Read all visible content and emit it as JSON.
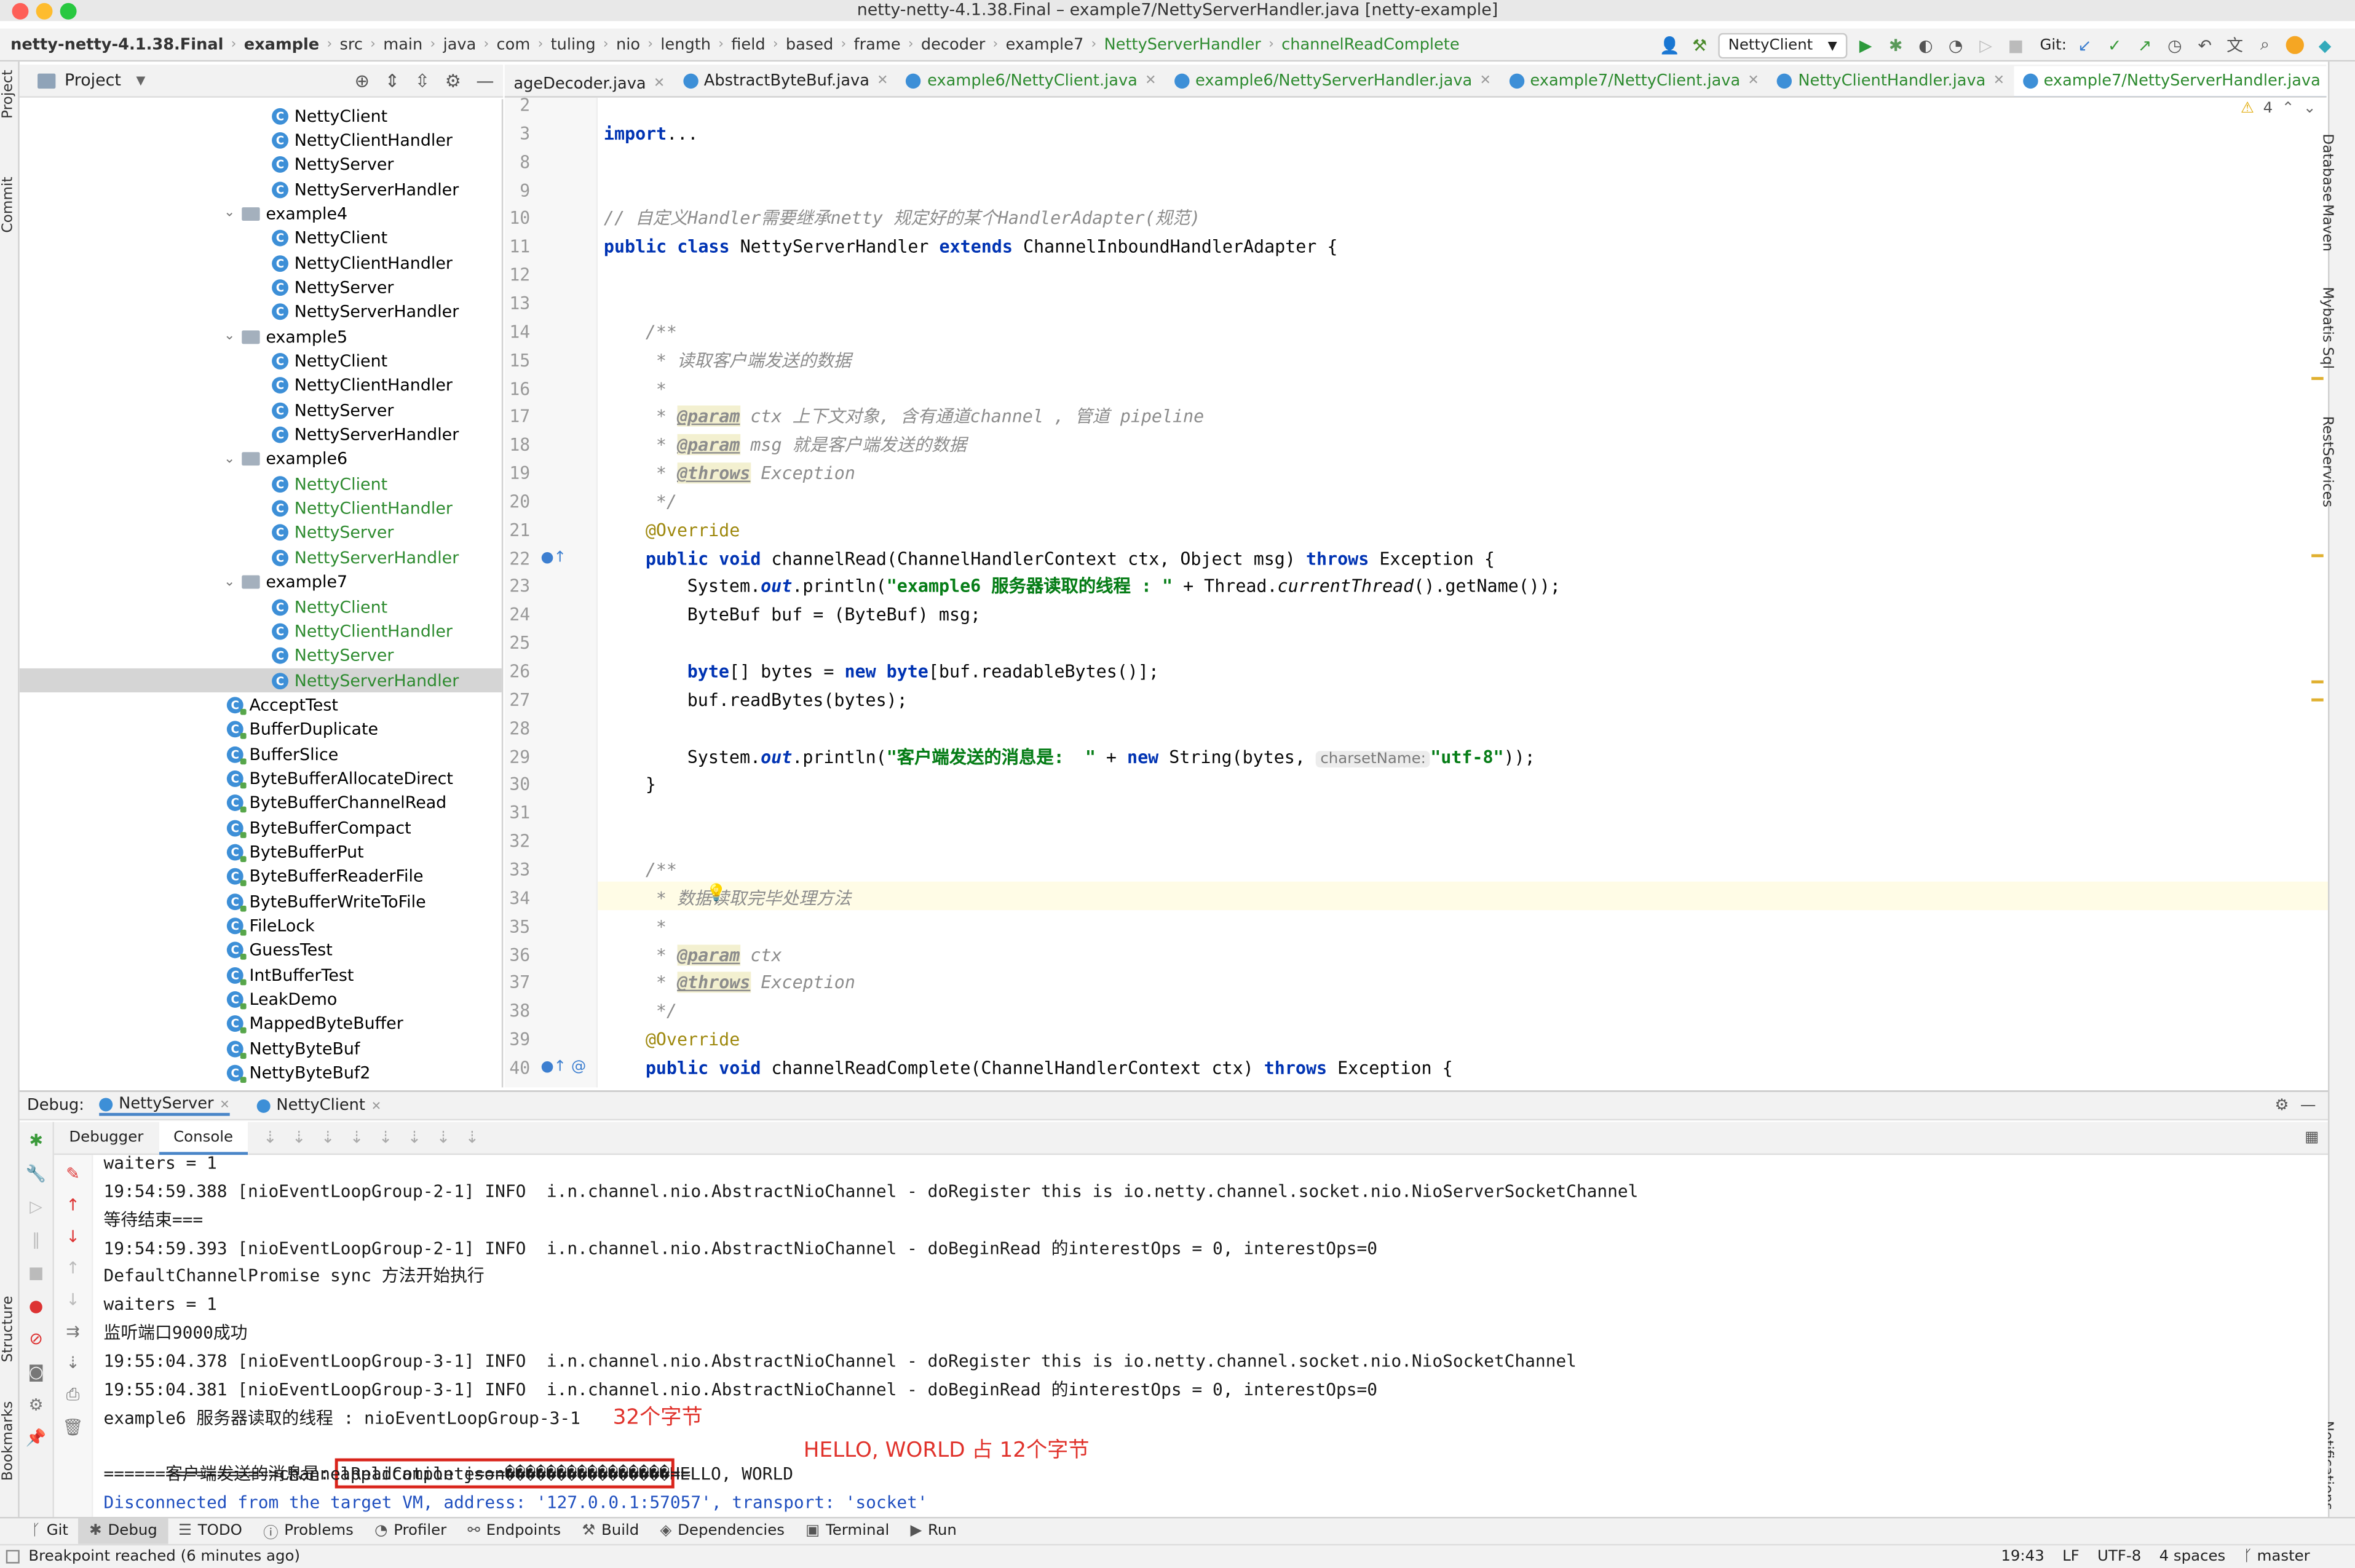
{
  "window": {
    "title": "netty-netty-4.1.38.Final – example7/NettyServerHandler.java [netty-example]"
  },
  "breadcrumbs": [
    "netty-netty-4.1.38.Final",
    "example",
    "src",
    "main",
    "java",
    "com",
    "tuling",
    "nio",
    "length",
    "field",
    "based",
    "frame",
    "decoder",
    "example7",
    "NettyServerHandler",
    "channelReadComplete"
  ],
  "toolbar": {
    "run_config": "NettyClient",
    "git_label": "Git:"
  },
  "left_strip": {
    "project": "Project",
    "commit": "Commit",
    "structure": "Structure",
    "bookmarks": "Bookmarks"
  },
  "right_strip": {
    "database": "Database",
    "maven": "Maven",
    "mybatis": "Mybatis Sql",
    "rest": "RestServices",
    "notifications": "Notifications"
  },
  "project": {
    "title": "Project",
    "tree": [
      {
        "label": "NettyClient",
        "kind": "class",
        "depth": 2,
        "color": "#000000"
      },
      {
        "label": "NettyClientHandler",
        "kind": "class",
        "depth": 2,
        "color": "#000000"
      },
      {
        "label": "NettyServer",
        "kind": "class",
        "depth": 2,
        "color": "#000000"
      },
      {
        "label": "NettyServerHandler",
        "kind": "class",
        "depth": 2,
        "color": "#000000"
      },
      {
        "label": "example4",
        "kind": "folder",
        "depth": 1,
        "color": "#000000"
      },
      {
        "label": "NettyClient",
        "kind": "class",
        "depth": 2,
        "color": "#000000"
      },
      {
        "label": "NettyClientHandler",
        "kind": "class",
        "depth": 2,
        "color": "#000000"
      },
      {
        "label": "NettyServer",
        "kind": "class",
        "depth": 2,
        "color": "#000000"
      },
      {
        "label": "NettyServerHandler",
        "kind": "class",
        "depth": 2,
        "color": "#000000"
      },
      {
        "label": "example5",
        "kind": "folder",
        "depth": 1,
        "color": "#000000"
      },
      {
        "label": "NettyClient",
        "kind": "class",
        "depth": 2,
        "color": "#000000"
      },
      {
        "label": "NettyClientHandler",
        "kind": "class",
        "depth": 2,
        "color": "#000000"
      },
      {
        "label": "NettyServer",
        "kind": "class",
        "depth": 2,
        "color": "#000000"
      },
      {
        "label": "NettyServerHandler",
        "kind": "class",
        "depth": 2,
        "color": "#000000"
      },
      {
        "label": "example6",
        "kind": "folder",
        "depth": 1,
        "color": "#000000"
      },
      {
        "label": "NettyClient",
        "kind": "class",
        "depth": 2,
        "color": "#2e8b30"
      },
      {
        "label": "NettyClientHandler",
        "kind": "class",
        "depth": 2,
        "color": "#2e8b30"
      },
      {
        "label": "NettyServer",
        "kind": "class",
        "depth": 2,
        "color": "#2e8b30"
      },
      {
        "label": "NettyServerHandler",
        "kind": "class",
        "depth": 2,
        "color": "#2e8b30"
      },
      {
        "label": "example7",
        "kind": "folder",
        "depth": 1,
        "color": "#000000"
      },
      {
        "label": "NettyClient",
        "kind": "class",
        "depth": 2,
        "color": "#2e8b30"
      },
      {
        "label": "NettyClientHandler",
        "kind": "class",
        "depth": 2,
        "color": "#2e8b30"
      },
      {
        "label": "NettyServer",
        "kind": "class",
        "depth": 2,
        "color": "#2e8b30"
      },
      {
        "label": "NettyServerHandler",
        "kind": "class",
        "depth": 2,
        "color": "#2e8b30",
        "selected": true
      },
      {
        "label": "AcceptTest",
        "kind": "class",
        "depth": 0,
        "color": "#000000"
      },
      {
        "label": "BufferDuplicate",
        "kind": "class",
        "depth": 0,
        "color": "#000000"
      },
      {
        "label": "BufferSlice",
        "kind": "class",
        "depth": 0,
        "color": "#000000"
      },
      {
        "label": "ByteBufferAllocateDirect",
        "kind": "class",
        "depth": 0,
        "color": "#000000"
      },
      {
        "label": "ByteBufferChannelRead",
        "kind": "class",
        "depth": 0,
        "color": "#000000"
      },
      {
        "label": "ByteBufferCompact",
        "kind": "class",
        "depth": 0,
        "color": "#000000"
      },
      {
        "label": "ByteBufferPut",
        "kind": "class",
        "depth": 0,
        "color": "#000000"
      },
      {
        "label": "ByteBufferReaderFile",
        "kind": "class",
        "depth": 0,
        "color": "#000000"
      },
      {
        "label": "ByteBufferWriteToFile",
        "kind": "class",
        "depth": 0,
        "color": "#000000"
      },
      {
        "label": "FileLock",
        "kind": "class",
        "depth": 0,
        "color": "#000000"
      },
      {
        "label": "GuessTest",
        "kind": "class",
        "depth": 0,
        "color": "#000000"
      },
      {
        "label": "IntBufferTest",
        "kind": "class",
        "depth": 0,
        "color": "#000000"
      },
      {
        "label": "LeakDemo",
        "kind": "class",
        "depth": 0,
        "color": "#000000"
      },
      {
        "label": "MappedByteBuffer",
        "kind": "class",
        "depth": 0,
        "color": "#000000"
      },
      {
        "label": "NettyByteBuf",
        "kind": "class",
        "depth": 0,
        "color": "#000000"
      },
      {
        "label": "NettyByteBuf2",
        "kind": "class",
        "depth": 0,
        "color": "#000000"
      }
    ]
  },
  "editor": {
    "tabs": [
      {
        "label": "ageDecoder.java",
        "color": "#222222"
      },
      {
        "label": "AbstractByteBuf.java",
        "color": "#222222"
      },
      {
        "label": "example6/NettyClient.java",
        "color": "#2e8b30"
      },
      {
        "label": "example6/NettyServerHandler.java",
        "color": "#2e8b30"
      },
      {
        "label": "example7/NettyClient.java",
        "color": "#2e8b30"
      },
      {
        "label": "NettyClientHandler.java",
        "color": "#2e8b30"
      },
      {
        "label": "example7/NettyServerHandler.java",
        "color": "#2e8b30",
        "active": true
      },
      {
        "label": "NettyServer.java",
        "color": "#2e8b30"
      }
    ],
    "warning_count": "4",
    "line_numbers": [
      "2",
      "3",
      "8",
      "9",
      "10",
      "11",
      "12",
      "13",
      "14",
      "15",
      "16",
      "17",
      "18",
      "19",
      "20",
      "21",
      "22",
      "23",
      "24",
      "25",
      "26",
      "27",
      "28",
      "29",
      "30",
      "31",
      "32",
      "33",
      "34",
      "35",
      "36",
      "37",
      "38",
      "39",
      "40"
    ],
    "lines": {
      "l3_import": "import",
      "l3_dots": "...",
      "l10": "// 自定义Handler需要继承netty 规定好的某个HandlerAdapter(规范)",
      "l11_a": "public class ",
      "l11_b": "NettyServerHandler ",
      "l11_c": "extends ",
      "l11_d": "ChannelInboundHandlerAdapter {",
      "l14": "/**",
      "l15": " * 读取客户端发送的数据",
      "l16": " *",
      "l17_a": " * ",
      "l17_tag": "@param",
      "l17_b": " ctx",
      "l17_c": " 上下文对象, 含有通道channel , 管道 pipeline",
      "l18_a": " * ",
      "l18_tag": "@param",
      "l18_b": " msg",
      "l18_c": " 就是客户端发送的数据",
      "l19_a": " * ",
      "l19_tag": "@throws",
      "l19_b": " Exception",
      "l20": " */",
      "l21": "@Override",
      "l22_a": "public void ",
      "l22_b": "channelRead(ChannelHandlerContext ctx, Object msg) ",
      "l22_c": "throws ",
      "l22_d": "Exception {",
      "l23_a": "System.",
      "l23_b": "out",
      "l23_c": ".println(",
      "l23_d": "\"example6 服务器读取的线程 : \"",
      "l23_e": " + Thread.",
      "l23_f": "currentThread",
      "l23_g": "().getName());",
      "l24": "ByteBuf buf = (ByteBuf) msg;",
      "l26_a": "byte",
      "l26_b": "[] bytes = ",
      "l26_c": "new byte",
      "l26_d": "[buf.readableBytes()];",
      "l27": "buf.readBytes(bytes);",
      "l29_a": "System.",
      "l29_b": "out",
      "l29_c": ".println(",
      "l29_d": "\"客户端发送的消息是:  \"",
      "l29_e": " + ",
      "l29_f": "new ",
      "l29_g": "String(bytes, ",
      "l29_hint": "charsetName:",
      "l29_h": "\"utf-8\"",
      "l29_i": "));",
      "l30": "}",
      "l33": "/**",
      "l34": " * 数据读取完毕处理方法",
      "l35": " *",
      "l36_a": " * ",
      "l36_tag": "@param",
      "l36_b": " ctx",
      "l37_a": " * ",
      "l37_tag": "@throws",
      "l37_b": " Exception",
      "l38": " */",
      "l39": "@Override",
      "l40_a": "public void ",
      "l40_b": "channelReadComplete(ChannelHandlerContext ctx) ",
      "l40_c": "throws ",
      "l40_d": "Exception {"
    }
  },
  "debug": {
    "label": "Debug:",
    "sessions": [
      "NettyServer",
      "NettyClient"
    ],
    "tabs": [
      "Debugger",
      "Console"
    ],
    "console_lines": [
      "waiters = 1",
      "19:54:59.388 [nioEventLoopGroup-2-1] INFO  i.n.channel.nio.AbstractNioChannel - doRegister this is io.netty.channel.socket.nio.NioServerSocketChannel",
      "等待结束===",
      "19:54:59.393 [nioEventLoopGroup-2-1] INFO  i.n.channel.nio.AbstractNioChannel - doBeginRead 的interestOps = 0, interestOps=0",
      "DefaultChannelPromise sync 方法开始执行",
      "waiters = 1",
      "监听端口9000成功",
      "19:55:04.378 [nioEventLoopGroup-3-1] INFO  i.n.channel.nio.AbstractNioChannel - doRegister this is io.netty.channel.socket.nio.NioSocketChannel",
      "19:55:04.381 [nioEventLoopGroup-3-1] INFO  i.n.channel.nio.AbstractNioChannel - doBeginRead 的interestOps = 0, interestOps=0",
      "example6 服务器读取的线程 : nioEventLoopGroup-3-1"
    ],
    "msg_prefix": "客户端发送的消息是: ",
    "msg_boxed": "application json����������������",
    "msg_rest": "HELLO, WORLD",
    "separator": "=================channelReadComplete=====================",
    "disconnected": "Disconnected from the target VM, address: '127.0.0.1:57057', transport: 'socket'",
    "annotation_32": "32个字节",
    "annotation_12": "HELLO, WORLD 占 12个字节"
  },
  "bottom_tools": [
    {
      "label": "Git",
      "icon": "git-branch-icon"
    },
    {
      "label": "Debug",
      "icon": "bug-icon",
      "active": true
    },
    {
      "label": "TODO",
      "icon": "list-icon"
    },
    {
      "label": "Problems",
      "icon": "info-icon"
    },
    {
      "label": "Profiler",
      "icon": "profiler-icon"
    },
    {
      "label": "Endpoints",
      "icon": "endpoints-icon"
    },
    {
      "label": "Build",
      "icon": "hammer-icon"
    },
    {
      "label": "Dependencies",
      "icon": "layers-icon"
    },
    {
      "label": "Terminal",
      "icon": "terminal-icon"
    },
    {
      "label": "Run",
      "icon": "play-icon"
    }
  ],
  "status": {
    "message": "Breakpoint reached (6 minutes ago)",
    "time": "19:43",
    "line_sep": "LF",
    "encoding": "UTF-8",
    "indent": "4 spaces",
    "branch": "master"
  },
  "colors": {
    "accent": "#4a86c8",
    "annotation_red": "#e0322b",
    "green_vcs": "#2e8b30"
  }
}
